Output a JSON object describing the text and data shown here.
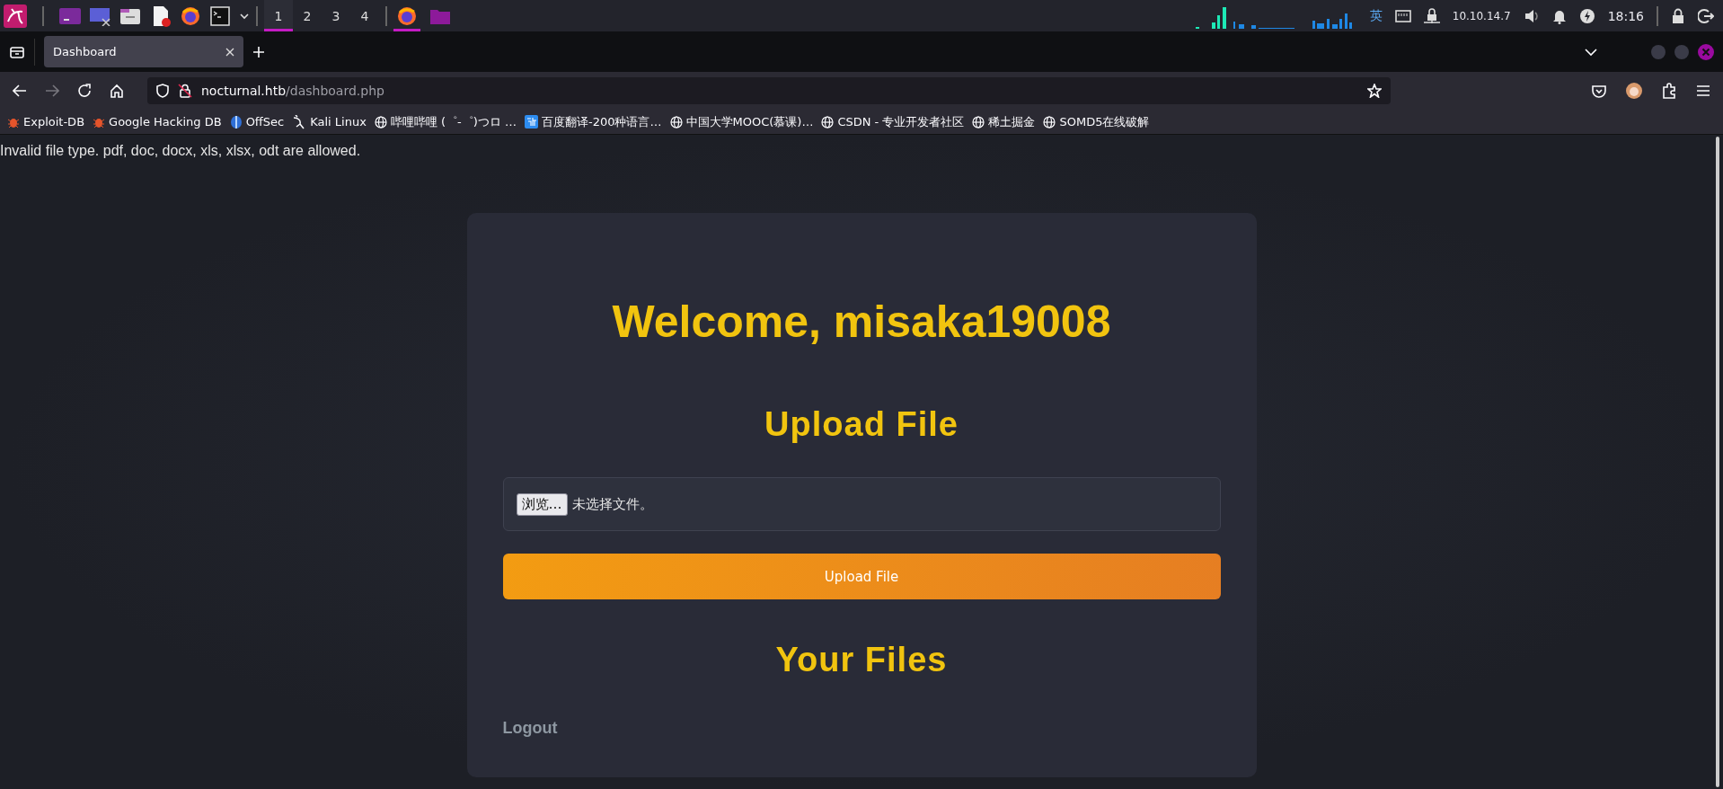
{
  "taskbar": {
    "workspaces": [
      {
        "label": "1",
        "selected": true
      },
      {
        "label": "2",
        "selected": false
      },
      {
        "label": "3",
        "selected": false
      },
      {
        "label": "4",
        "selected": false
      }
    ],
    "input_method": "英",
    "ip": "10.10.14.7",
    "clock": "18:16"
  },
  "browser": {
    "tabs": [
      {
        "label": "Dashboard",
        "selected": true
      }
    ],
    "url_host": "nocturnal.htb",
    "url_path": "/dashboard.php",
    "bookmarks": [
      {
        "label": "Exploit-DB",
        "kind": "bug"
      },
      {
        "label": "Google Hacking DB",
        "kind": "bug"
      },
      {
        "label": "OffSec",
        "kind": "offsec"
      },
      {
        "label": "Kali Linux",
        "kind": "kali"
      },
      {
        "label": "哔哩哔哩 (゜-゜)つロ …",
        "kind": "globe"
      },
      {
        "label": "百度翻译-200种语言…",
        "kind": "translate"
      },
      {
        "label": "中国大学MOOC(慕课)…",
        "kind": "globe"
      },
      {
        "label": "CSDN - 专业开发者社区",
        "kind": "globe"
      },
      {
        "label": "稀土掘金",
        "kind": "globe"
      },
      {
        "label": "SOMD5在线破解",
        "kind": "globe"
      }
    ]
  },
  "page": {
    "message": "Invalid file type. pdf, doc, docx, xls, xlsx, odt are allowed.",
    "title": "Welcome, misaka19008",
    "upload_heading": "Upload File",
    "file_input": {
      "button": "浏览…",
      "status": "未选择文件。"
    },
    "upload_button": "Upload File",
    "files_heading": "Your Files",
    "logout": "Logout"
  }
}
